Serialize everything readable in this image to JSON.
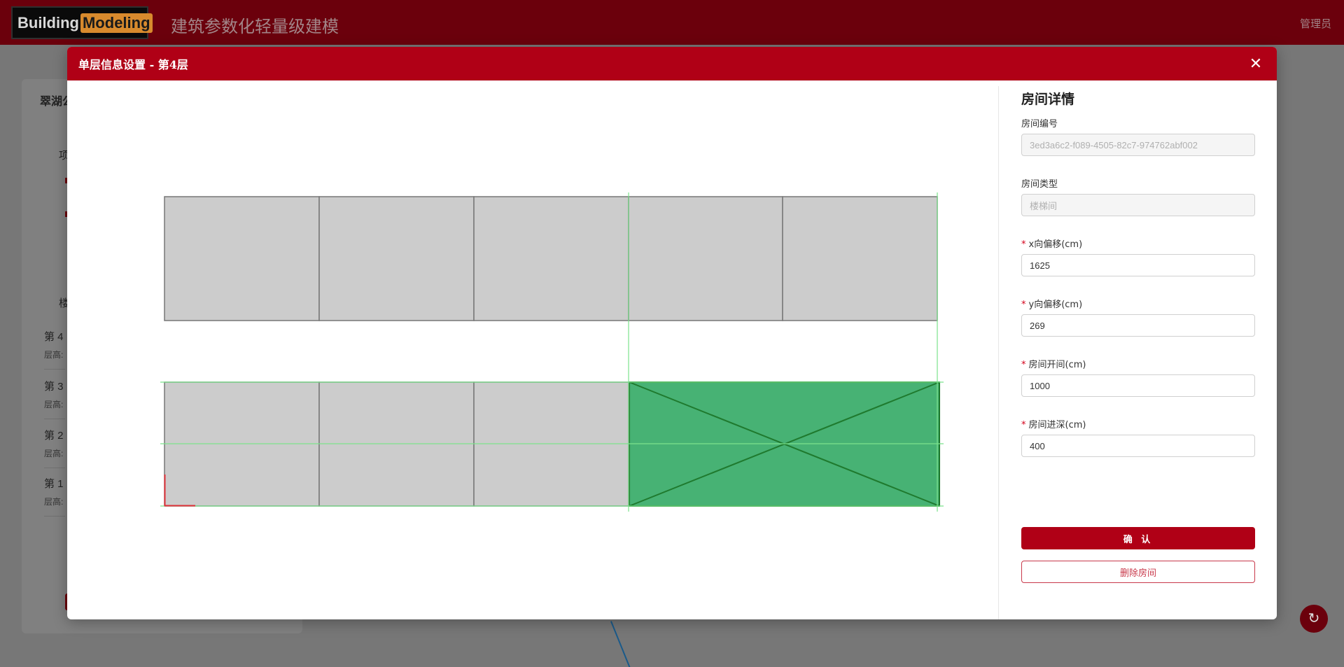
{
  "header": {
    "logo_part1": "Building",
    "logo_part2": "Modeling",
    "app_title": "建筑参数化轻量级建模",
    "user": "管理员"
  },
  "background": {
    "panel_title": "翠湖公",
    "section1": "项",
    "section2": "楼",
    "floors": [
      {
        "name": "第 4",
        "sub": "层高:"
      },
      {
        "name": "第 3",
        "sub": "层高:"
      },
      {
        "name": "第 2",
        "sub": "层高:"
      },
      {
        "name": "第 1",
        "sub": "层高:"
      }
    ]
  },
  "modal": {
    "title": "单层信息设置 - 第4层",
    "close_icon": "close-icon"
  },
  "detail": {
    "heading": "房间详情",
    "room_id_label": "房间编号",
    "room_id_value": "3ed3a6c2-f089-4505-82c7-974762abf002",
    "room_type_label": "房间类型",
    "room_type_value": "楼梯间",
    "x_offset_label": "x向偏移(cm)",
    "x_offset_value": "1625",
    "y_offset_label": "y向偏移(cm)",
    "y_offset_value": "269",
    "width_label": "房间开间(cm)",
    "width_value": "1000",
    "depth_label": "房间进深(cm)",
    "depth_value": "400",
    "confirm_label": "确 认",
    "delete_label": "删除房间"
  },
  "colors": {
    "header": "#6b000c",
    "modal_header": "#b00016",
    "room_fill": "#cccccc",
    "selected_fill": "#47b274",
    "guide": "#7be38c"
  }
}
